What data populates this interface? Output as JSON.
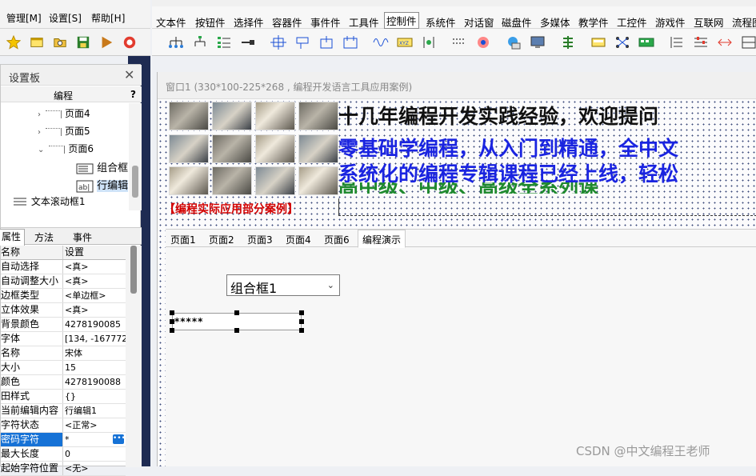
{
  "menu": {
    "items": [
      "管理[M]",
      "设置[S]",
      "帮助[H]"
    ]
  },
  "toolbar_icons": [
    "star-icon",
    "window-icon",
    "folder-icon",
    "save-icon",
    "run-icon",
    "stop-icon"
  ],
  "component_tabs": {
    "items": [
      "文本件",
      "按钮件",
      "选择件",
      "容器件",
      "事件件",
      "工具件",
      "控制件",
      "系统件",
      "对话窗",
      "磁盘件",
      "多媒体",
      "教学件",
      "工控件",
      "游戏件",
      "互联网",
      "流程图"
    ],
    "active": "控制件"
  },
  "settings_panel": {
    "title": "设置板",
    "section_title": "编程",
    "help": "?",
    "tree": [
      {
        "label": "页面4",
        "expander": "›"
      },
      {
        "label": "页面5",
        "expander": "›"
      },
      {
        "label": "页面6",
        "expander": "⌄"
      },
      {
        "label": "组合框"
      },
      {
        "label": "行编辑"
      },
      {
        "label": "文本滚动框1"
      }
    ],
    "tabs": [
      "属性",
      "方法",
      "事件"
    ],
    "grid_header": {
      "name": "名称",
      "value": "设置"
    },
    "properties": [
      {
        "name": "自动选择",
        "value": "<真>"
      },
      {
        "name": "自动调整大小",
        "value": "<真>"
      },
      {
        "name": "边框类型",
        "value": "<单边框>"
      },
      {
        "name": "立体效果",
        "value": "<真>"
      },
      {
        "name": "背景颜色",
        "value": "4278190085"
      },
      {
        "name": "字体",
        "value": "[134, -167772"
      },
      {
        "name": "  名称",
        "value": "宋体"
      },
      {
        "name": "  大小",
        "value": "15"
      },
      {
        "name": "  颜色",
        "value": "4278190088"
      },
      {
        "name": "田样式",
        "value": "{}"
      },
      {
        "name": "当前编辑内容",
        "value": "行编辑1"
      },
      {
        "name": "字符状态",
        "value": "<正常>"
      },
      {
        "name": "密码字符",
        "value": "*"
      },
      {
        "name": "最大长度",
        "value": "0"
      },
      {
        "name": "起始字符位置",
        "value": "<无>"
      }
    ],
    "selected_row": "密码字符"
  },
  "design_window": {
    "title": "窗口1 (330*100-225*268 , 编程开发语言工具应用案例)",
    "headline": "十几年编程开发实践经验，欢迎提问",
    "line2": "零基础学编程，从入门到精通，全中文",
    "line3": "系统化的编程专辑课程已经上线，轻松",
    "line4": "高中级、中级、高级全系列课",
    "red_label": "【编程实际应用部分案例】",
    "tabs": [
      "页面1",
      "页面2",
      "页面3",
      "页面4",
      "页面6",
      "编程演示"
    ],
    "active_tab": "编程演示",
    "combo_value": "组合框1",
    "password_value": "*****"
  },
  "watermark": "CSDN @中文编程王老师"
}
